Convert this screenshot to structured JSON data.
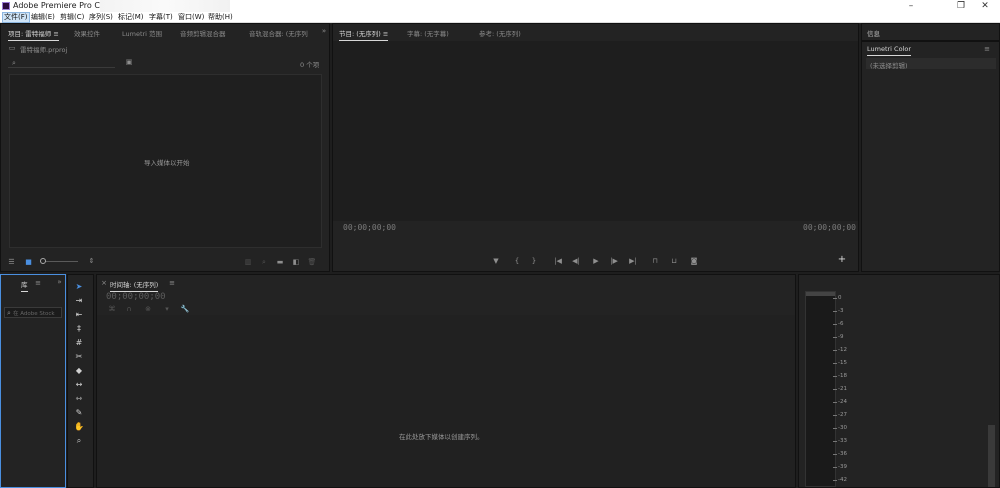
{
  "window": {
    "title": "Adobe Premiere Pro CC 2017"
  },
  "menu": [
    {
      "label": "文件(F)"
    },
    {
      "label": "编辑(E)"
    },
    {
      "label": "剪辑(C)"
    },
    {
      "label": "序列(S)"
    },
    {
      "label": "标记(M)"
    },
    {
      "label": "字幕(T)"
    },
    {
      "label": "窗口(W)"
    },
    {
      "label": "帮助(H)"
    }
  ],
  "project_panel": {
    "tabs": [
      "项目: 雷特福师 ≡",
      "效果控件",
      "Lumetri 范围",
      "音频剪辑混合器",
      "音轨混合器: (无序列"
    ],
    "file_name": "雷特福师.prproj",
    "item_count": "0 个项",
    "empty_hint": "导入媒体以开始"
  },
  "program_monitor": {
    "tabs": [
      "节目: (无序列) ≡",
      "字幕: (无字幕)",
      "参考: (无序列)"
    ],
    "timecode_left": "00;00;00;00",
    "timecode_right": "00;00;00;00"
  },
  "right_panels": {
    "info_title": "信息",
    "lumetri_title": "Lumetri Color",
    "lumetri_clip": "(未选择剪辑)"
  },
  "library_panel": {
    "tab": "库",
    "search_placeholder": "在 Adobe Stock"
  },
  "timeline_panel": {
    "tab": "时间轴: (无序列)",
    "timecode": "00;00;00;00",
    "empty_hint": "在此处放下媒体以创建序列。"
  },
  "audio_meter": {
    "ticks": [
      "0",
      "-3",
      "-6",
      "-9",
      "-12",
      "-15",
      "-18",
      "-21",
      "-24",
      "-27",
      "-30",
      "-33",
      "-36",
      "-39",
      "-42"
    ]
  },
  "icons": {
    "tools": [
      "selection-icon",
      "track-select-icon",
      "ripple-edit-icon",
      "rolling-edit-icon",
      "rate-stretch-icon",
      "razor-icon",
      "slip-icon",
      "slide-icon",
      "pen-icon",
      "hand-icon",
      "zoom-icon"
    ]
  }
}
